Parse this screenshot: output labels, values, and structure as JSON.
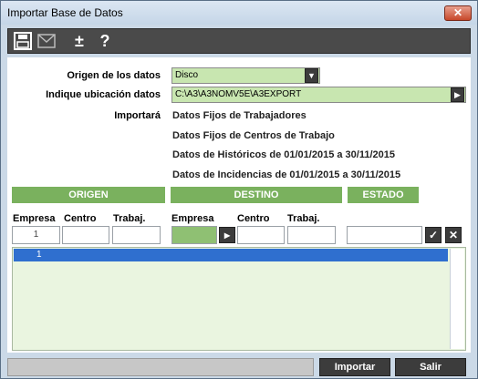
{
  "window": {
    "title": "Importar Base de Datos",
    "close_label": "✕"
  },
  "toolbar": {
    "items": [
      {
        "icon": "floppy-disk-icon"
      },
      {
        "icon": "envelope-icon"
      },
      {
        "icon": "plus-minus-icon",
        "label": "±"
      },
      {
        "icon": "help-icon",
        "label": "?"
      }
    ]
  },
  "form": {
    "origen_label": "Origen de los datos",
    "origen_value": "Disco",
    "ubicacion_label": "Indique ubicación datos",
    "ubicacion_value": "C:\\A3\\A3NOMV5E\\A3EXPORT",
    "importara_label": "Importará",
    "importara_items": [
      "Datos Fijos de Trabajadores",
      "Datos Fijos de Centros de Trabajo",
      "Datos de Históricos de 01/01/2015 a 30/11/2015",
      "Datos de Incidencias de 01/01/2015 a 30/11/2015"
    ]
  },
  "sections": {
    "origen": "ORIGEN",
    "destino": "DESTINO",
    "estado": "ESTADO"
  },
  "columns": {
    "origen": [
      "Empresa",
      "Centro",
      "Trabaj."
    ],
    "destino": [
      "Empresa",
      "Centro",
      "Trabaj."
    ]
  },
  "inputs": {
    "origen_empresa": "1",
    "origen_centro": "",
    "origen_trabaj": "",
    "destino_empresa": "",
    "destino_centro": "",
    "destino_trabaj": "",
    "estado": ""
  },
  "list": {
    "rows": [
      "1"
    ]
  },
  "buttons": {
    "importar": "Importar",
    "salir": "Salir"
  },
  "colors": {
    "accent_green": "#7ab15e",
    "selection_blue": "#2f6fcf"
  }
}
